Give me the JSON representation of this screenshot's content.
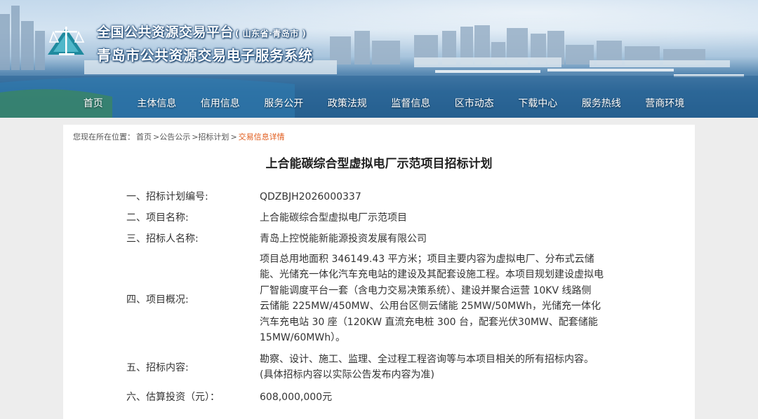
{
  "header": {
    "title": "全国公共资源交易平台",
    "region": "( 山东省·青岛市 )",
    "subtitle": "青岛市公共资源交易电子服务系统"
  },
  "nav": {
    "items": [
      "首页",
      "主体信息",
      "信用信息",
      "服务公开",
      "政策法规",
      "监督信息",
      "区市动态",
      "下载中心",
      "服务热线",
      "营商环境"
    ]
  },
  "breadcrumb": {
    "prefix": "您现在所在位置：",
    "items": [
      "首页",
      ">公告公示",
      ">招标计划",
      ">"
    ],
    "current": "交易信息详情"
  },
  "page": {
    "title": "上合能碳综合型虚拟电厂示范项目招标计划"
  },
  "details": [
    {
      "label": "一、招标计划编号:",
      "lines": [
        "QDZBJH2026000337"
      ]
    },
    {
      "label": "二、项目名称:",
      "lines": [
        "上合能碳综合型虚拟电厂示范项目"
      ]
    },
    {
      "label": "三、招标人名称:",
      "lines": [
        "青岛上控悦能新能源投资发展有限公司"
      ]
    },
    {
      "label": "四、项目概况:",
      "lines": [
        "项目总用地面积 346149.43 平方米；项目主要内容为虚拟电厂、分布式云储",
        "能、光储充一体化汽车充电站的建设及其配套设施工程。本项目规划建设虚拟电",
        "厂智能调度平台一套（含电力交易决策系统）、建设并聚合运营 10KV 线路侧",
        "云储能 225MW/450MW、公用台区侧云储能 25MW/50MWh，光储充一体化",
        "汽车充电站 30 座（120KW 直流充电桩 300 台，配套光伏30MW、配套储能",
        "15MW/60MWh）。"
      ]
    },
    {
      "label": "五、招标内容:",
      "lines": [
        "勘察、设计、施工、监理、全过程工程咨询等与本项目相关的所有招标内容。",
        "(具体招标内容以实际公告发布内容为准)"
      ]
    },
    {
      "label": "六、估算投资（元）：",
      "lines": [
        "608,000,000元"
      ]
    }
  ]
}
